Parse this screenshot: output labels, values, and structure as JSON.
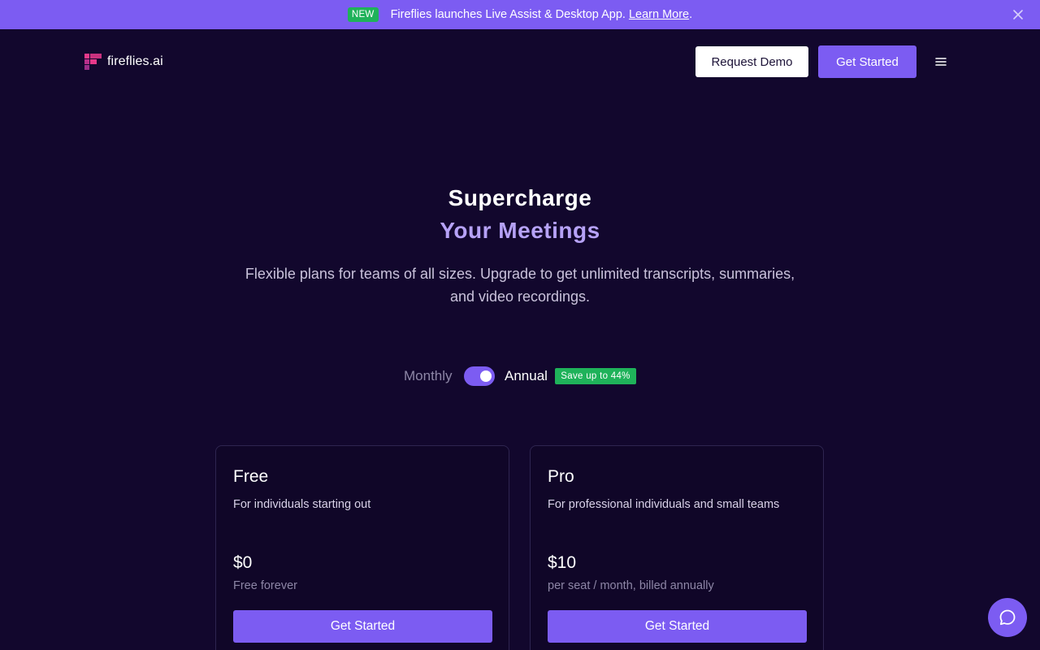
{
  "announcement": {
    "badge": "NEW",
    "text": "Fireflies launches Live Assist & Desktop App.",
    "link": "Learn More",
    "suffix": "."
  },
  "header": {
    "logo_text": "fireflies.ai",
    "request_demo": "Request Demo",
    "get_started": "Get Started"
  },
  "hero": {
    "title_line1": "Supercharge",
    "title_line2": "Your Meetings",
    "subtitle": "Flexible plans for teams of all sizes. Upgrade to get unlimited transcripts, summaries, and video recordings."
  },
  "billing": {
    "monthly": "Monthly",
    "annual": "Annual",
    "save_badge": "Save up to 44%",
    "selected": "Annual"
  },
  "plans": [
    {
      "name": "Free",
      "description": "For individuals starting out",
      "price": "$0",
      "price_note": "Free forever",
      "cta": "Get Started"
    },
    {
      "name": "Pro",
      "description": "For professional individuals and small teams",
      "price": "$10",
      "price_note": "per seat / month, billed annually",
      "cta": "Get Started"
    }
  ],
  "colors": {
    "background": "#12072d",
    "accent": "#7c5cf2",
    "badge_green": "#1fb25a",
    "title_highlight": "#b6a2f7"
  },
  "icons": {
    "close": "close-icon",
    "menu": "hamburger-menu-icon",
    "chat": "chat-bubble-icon",
    "logo": "fireflies-logo-icon"
  }
}
